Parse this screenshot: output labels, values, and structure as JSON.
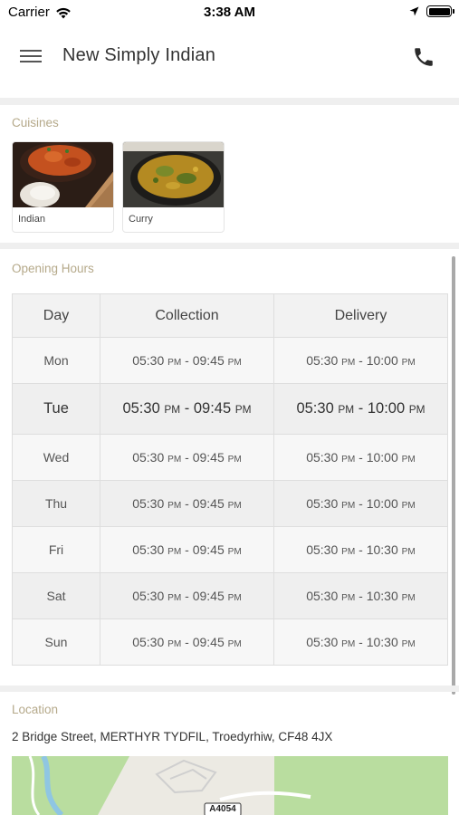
{
  "status_bar": {
    "carrier": "Carrier",
    "time": "3:38 AM"
  },
  "header": {
    "title": "New Simply Indian",
    "menu_icon": "hamburger-menu-icon",
    "phone_icon": "phone-icon"
  },
  "cuisines": {
    "label": "Cuisines",
    "items": [
      {
        "name": "Indian"
      },
      {
        "name": "Curry"
      }
    ]
  },
  "opening_hours": {
    "label": "Opening Hours",
    "headers": [
      "Day",
      "Collection",
      "Delivery"
    ],
    "rows": [
      {
        "day": "Mon",
        "collection": {
          "open": "05:30",
          "close": "09:45"
        },
        "delivery": {
          "open": "05:30",
          "close": "10:00"
        }
      },
      {
        "day": "Tue",
        "collection": {
          "open": "05:30",
          "close": "09:45"
        },
        "delivery": {
          "open": "05:30",
          "close": "10:00"
        }
      },
      {
        "day": "Wed",
        "collection": {
          "open": "05:30",
          "close": "09:45"
        },
        "delivery": {
          "open": "05:30",
          "close": "10:00"
        }
      },
      {
        "day": "Thu",
        "collection": {
          "open": "05:30",
          "close": "09:45"
        },
        "delivery": {
          "open": "05:30",
          "close": "10:00"
        }
      },
      {
        "day": "Fri",
        "collection": {
          "open": "05:30",
          "close": "09:45"
        },
        "delivery": {
          "open": "05:30",
          "close": "10:30"
        }
      },
      {
        "day": "Sat",
        "collection": {
          "open": "05:30",
          "close": "09:45"
        },
        "delivery": {
          "open": "05:30",
          "close": "10:30"
        }
      },
      {
        "day": "Sun",
        "collection": {
          "open": "05:30",
          "close": "09:45"
        },
        "delivery": {
          "open": "05:30",
          "close": "10:30"
        }
      }
    ],
    "meridiem": "PM",
    "separator": "-",
    "highlighted_day": "Tue"
  },
  "location": {
    "label": "Location",
    "address": "2 Bridge Street, MERTHYR TYDFIL, Troedyrhiw, CF48 4JX",
    "map_road_label": "A4054"
  },
  "colors": {
    "section_label": "#b5a98a",
    "divider": "#efefef",
    "map_green": "#b9dd9f"
  }
}
